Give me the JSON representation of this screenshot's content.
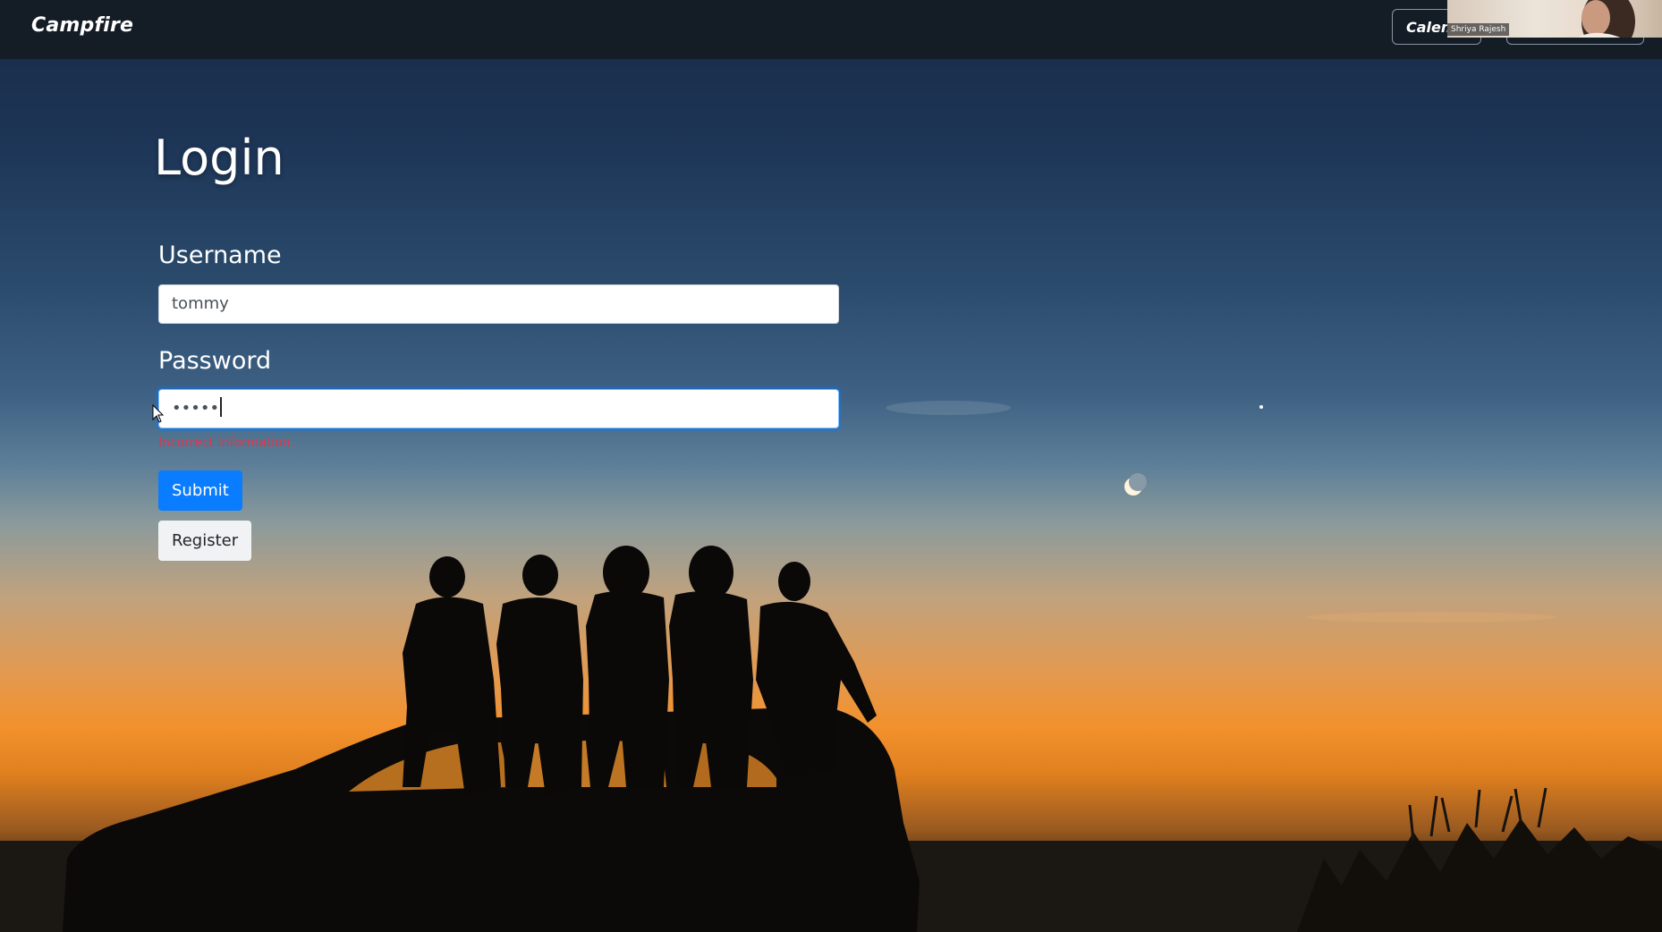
{
  "navbar": {
    "brand": "Campfire",
    "calendar_button": "Calendar",
    "second_button": ""
  },
  "video_overlay": {
    "participant_name": "Shriya Rajesh"
  },
  "login": {
    "title": "Login",
    "username_label": "Username",
    "username_value": "tommy",
    "password_label": "Password",
    "password_masked": "•••••",
    "error_message": "Incorrect Information.",
    "submit_label": "Submit",
    "register_label": "Register"
  },
  "colors": {
    "navbar_bg": "#141c26",
    "primary_button": "#0a7cff",
    "secondary_button": "#f1f2f4",
    "error_text": "#e0364c",
    "input_focus_border": "#80bdff"
  },
  "icons": {
    "cursor": "arrow-pointer-icon",
    "moon": "crescent-moon-icon"
  }
}
